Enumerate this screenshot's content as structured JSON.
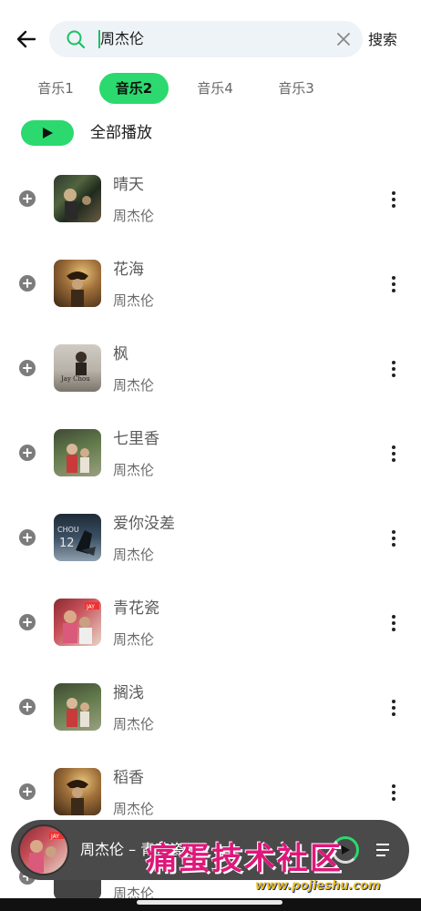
{
  "search": {
    "query": "周杰伦",
    "action_label": "搜索"
  },
  "tabs": [
    {
      "label": "音乐1",
      "active": false
    },
    {
      "label": "音乐2",
      "active": true
    },
    {
      "label": "音乐4",
      "active": false
    },
    {
      "label": "音乐3",
      "active": false
    }
  ],
  "play_all": {
    "label": "全部播放"
  },
  "songs": [
    {
      "title": "晴天",
      "artist": "周杰伦"
    },
    {
      "title": "花海",
      "artist": "周杰伦"
    },
    {
      "title": "枫",
      "artist": "周杰伦"
    },
    {
      "title": "七里香",
      "artist": "周杰伦"
    },
    {
      "title": "爱你没差",
      "artist": "周杰伦"
    },
    {
      "title": "青花瓷",
      "artist": "周杰伦"
    },
    {
      "title": "搁浅",
      "artist": "周杰伦"
    },
    {
      "title": "稻香",
      "artist": "周杰伦"
    }
  ],
  "mini_player": {
    "now_playing": "周杰伦 – 青花瓷"
  },
  "watermark": {
    "text": "痛蛋技术社区",
    "url": "www.pojieshu.com"
  },
  "colors": {
    "accent": "#2bd96f",
    "mini_player_bg": "#4a4a4a"
  }
}
